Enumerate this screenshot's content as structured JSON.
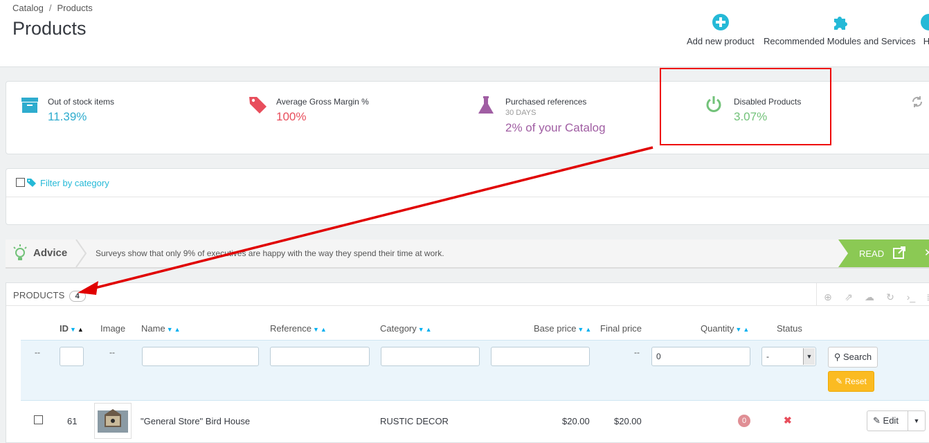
{
  "breadcrumb": {
    "items": [
      "Catalog",
      "Products"
    ]
  },
  "page_title": "Products",
  "toolbar": {
    "add_new_product": "Add new product",
    "recommended_modules": "Recommended Modules and Services",
    "help": "He"
  },
  "kpis": {
    "out_of_stock": {
      "label": "Out of stock items",
      "value": "11.39%"
    },
    "gross_margin": {
      "label": "Average Gross Margin %",
      "value": "100%"
    },
    "purchased_refs": {
      "label": "Purchased references",
      "period": "30 DAYS",
      "value": "2% of your Catalog"
    },
    "disabled_products": {
      "label": "Disabled Products",
      "value": "3.07%"
    }
  },
  "filter_panel": {
    "filter_by_category": "Filter by category"
  },
  "advice": {
    "label": "Advice",
    "text": "Surveys show that only 9% of executives are happy with the way they spend their time at work.",
    "read": "READ"
  },
  "products": {
    "heading": "PRODUCTS",
    "count": "4",
    "columns": [
      "ID",
      "Image",
      "Name",
      "Reference",
      "Category",
      "Base price",
      "Final price",
      "Quantity",
      "Status"
    ],
    "filter": {
      "id_placeholder": "--",
      "image_placeholder": "--",
      "final_price_placeholder": "--",
      "quantity_value": "0",
      "status_selected": "-",
      "search_label": "Search",
      "reset_label": "Reset"
    },
    "rows": [
      {
        "id": "61",
        "name": "\"General Store\" Bird House",
        "reference": "",
        "category": "RUSTIC DECOR",
        "base_price": "$20.00",
        "final_price": "$20.00",
        "quantity": "0",
        "edit_label": "Edit"
      }
    ]
  },
  "colors": {
    "accent_blue": "#25b9d7",
    "kpi_blue": "#2eacce",
    "kpi_red": "#e84e5c",
    "kpi_purple": "#a05ea3",
    "kpi_green": "#72c279",
    "annotation_red": "#e00000"
  }
}
